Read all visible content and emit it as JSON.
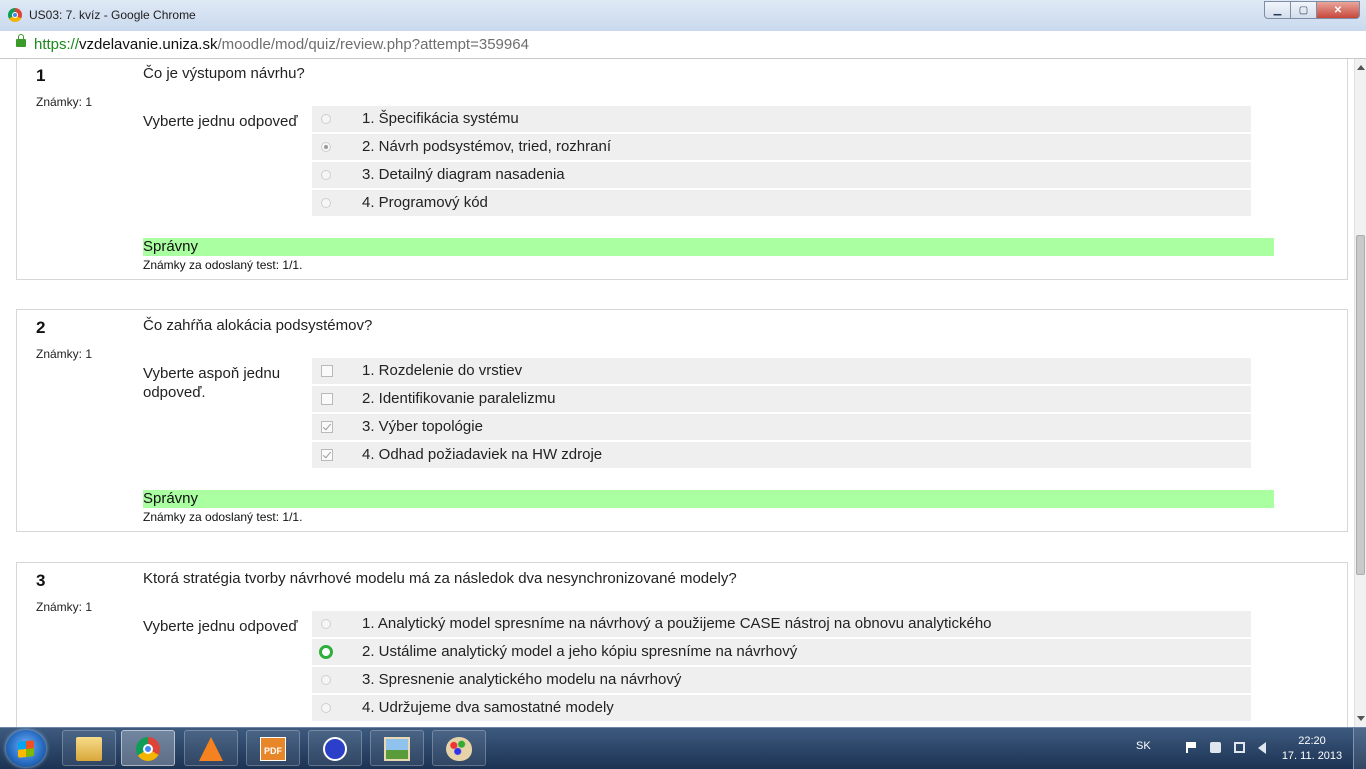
{
  "window": {
    "title": "US03: 7. kvíz - Google Chrome",
    "minimize": "▁",
    "maximize": "▢",
    "close": "✕"
  },
  "address": {
    "scheme": "https://",
    "host": "vzdelavanie.uniza.sk",
    "path": "/moodle/mod/quiz/review.php?attempt=359964"
  },
  "questions": [
    {
      "number": "1",
      "grade": "Známky: 1",
      "text": "Čo je výstupom návrhu?",
      "prompt": "Vyberte jednu odpoveď",
      "answers": [
        "1. Špecifikácia systému",
        "2. Návrh podsystémov, tried, rozhraní",
        "3. Detailný diagram nasadenia",
        "4. Programový kód"
      ],
      "feedback": "Správny",
      "grade_line": "Známky za odoslaný test: 1/1."
    },
    {
      "number": "2",
      "grade": "Známky: 1",
      "text": "Čo zahŕňa alokácia podsystémov?",
      "prompt": "Vyberte aspoň jednu odpoveď.",
      "answers": [
        "1. Rozdelenie do vrstiev",
        "2. Identifikovanie paralelizmu",
        "3. Výber topológie",
        "4. Odhad požiadaviek na HW zdroje"
      ],
      "feedback": "Správny",
      "grade_line": "Známky za odoslaný test: 1/1."
    },
    {
      "number": "3",
      "grade": "Známky: 1",
      "text": "Ktorá stratégia tvorby návrhové modelu má za následok dva nesynchronizované modely?",
      "prompt": "Vyberte jednu odpoveď",
      "answers": [
        "1. Analytický model spresníme na návrhový a použijeme CASE nástroj na obnovu analytického",
        "2. Ustálime analytický model a jeho kópiu spresníme na návrhový",
        "3. Spresnenie analytického modelu na návrhový",
        "4. Udržujeme dva samostatné modely"
      ]
    }
  ],
  "taskbar": {
    "language": "SK",
    "time": "22:20",
    "date": "17. 11. 2013",
    "apps": [
      "folder-icon",
      "chrome-icon",
      "vlc-icon",
      "pdf-icon",
      "eclipse-icon",
      "picture-viewer-icon",
      "paint-icon"
    ]
  },
  "colors": {
    "feedback_correct": "#aaffa0",
    "answer_row": "#efefef",
    "selected_correct_radio": "#2eaf3c",
    "url_scheme": "#1a8a1a"
  }
}
